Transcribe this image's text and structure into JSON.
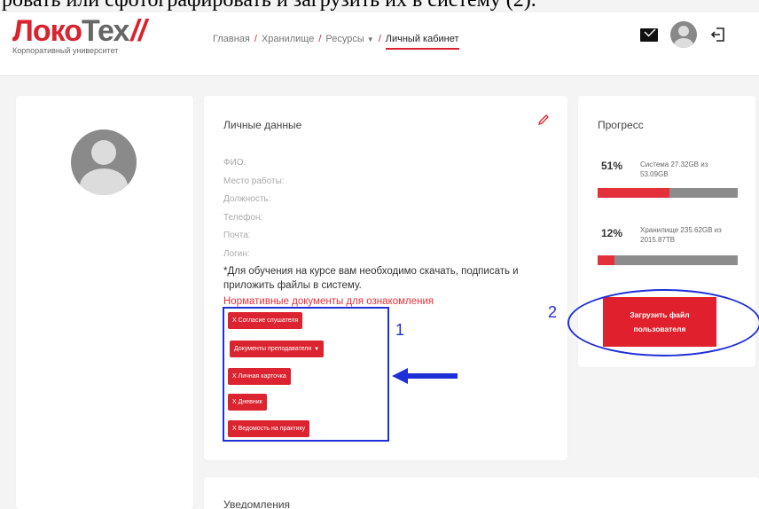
{
  "caption": "ровать или сфотографировать и загрузить их в систему (2).",
  "logo": {
    "main": "Локо",
    "accent": "Тех",
    "subtitle": "Корпоративный университет"
  },
  "nav": {
    "home": "Главная",
    "storage": "Хранилище",
    "resources": "Ресурсы",
    "cabinet": "Личный кабинет"
  },
  "personal": {
    "title": "Личные данные",
    "fields": [
      "ФИО:",
      "Место работы:",
      "Должность:",
      "Телефон:",
      "Почта:",
      "Логин:"
    ],
    "note": "*Для обучения на курсе вам необходимо скачать, подписать и приложить файлы в систему.",
    "docs_link": "Нормативные документы для ознакомления",
    "buttons": {
      "consent": "X Согласие слушателя",
      "teacher_docs": "Документы преподавателя",
      "personal_card": "X Личная карточка",
      "diary": "X Дневник",
      "practice": "X Ведомость на практику"
    }
  },
  "progress": {
    "title": "Прогресс",
    "system": {
      "pct_label": "51%",
      "fraction": 0.51,
      "desc": "Система 27.32GB из 53.09GB"
    },
    "storage": {
      "pct_label": "12%",
      "fraction": 0.12,
      "desc": "Хранилище 235.62GB из 2015.87TB"
    }
  },
  "upload_button": "Загрузить файл пользователя",
  "annotations": {
    "one": "1",
    "two": "2"
  },
  "notifications": {
    "title": "Уведомления"
  },
  "colors": {
    "accent": "#dc2430",
    "annotation": "#1f2fd6"
  }
}
